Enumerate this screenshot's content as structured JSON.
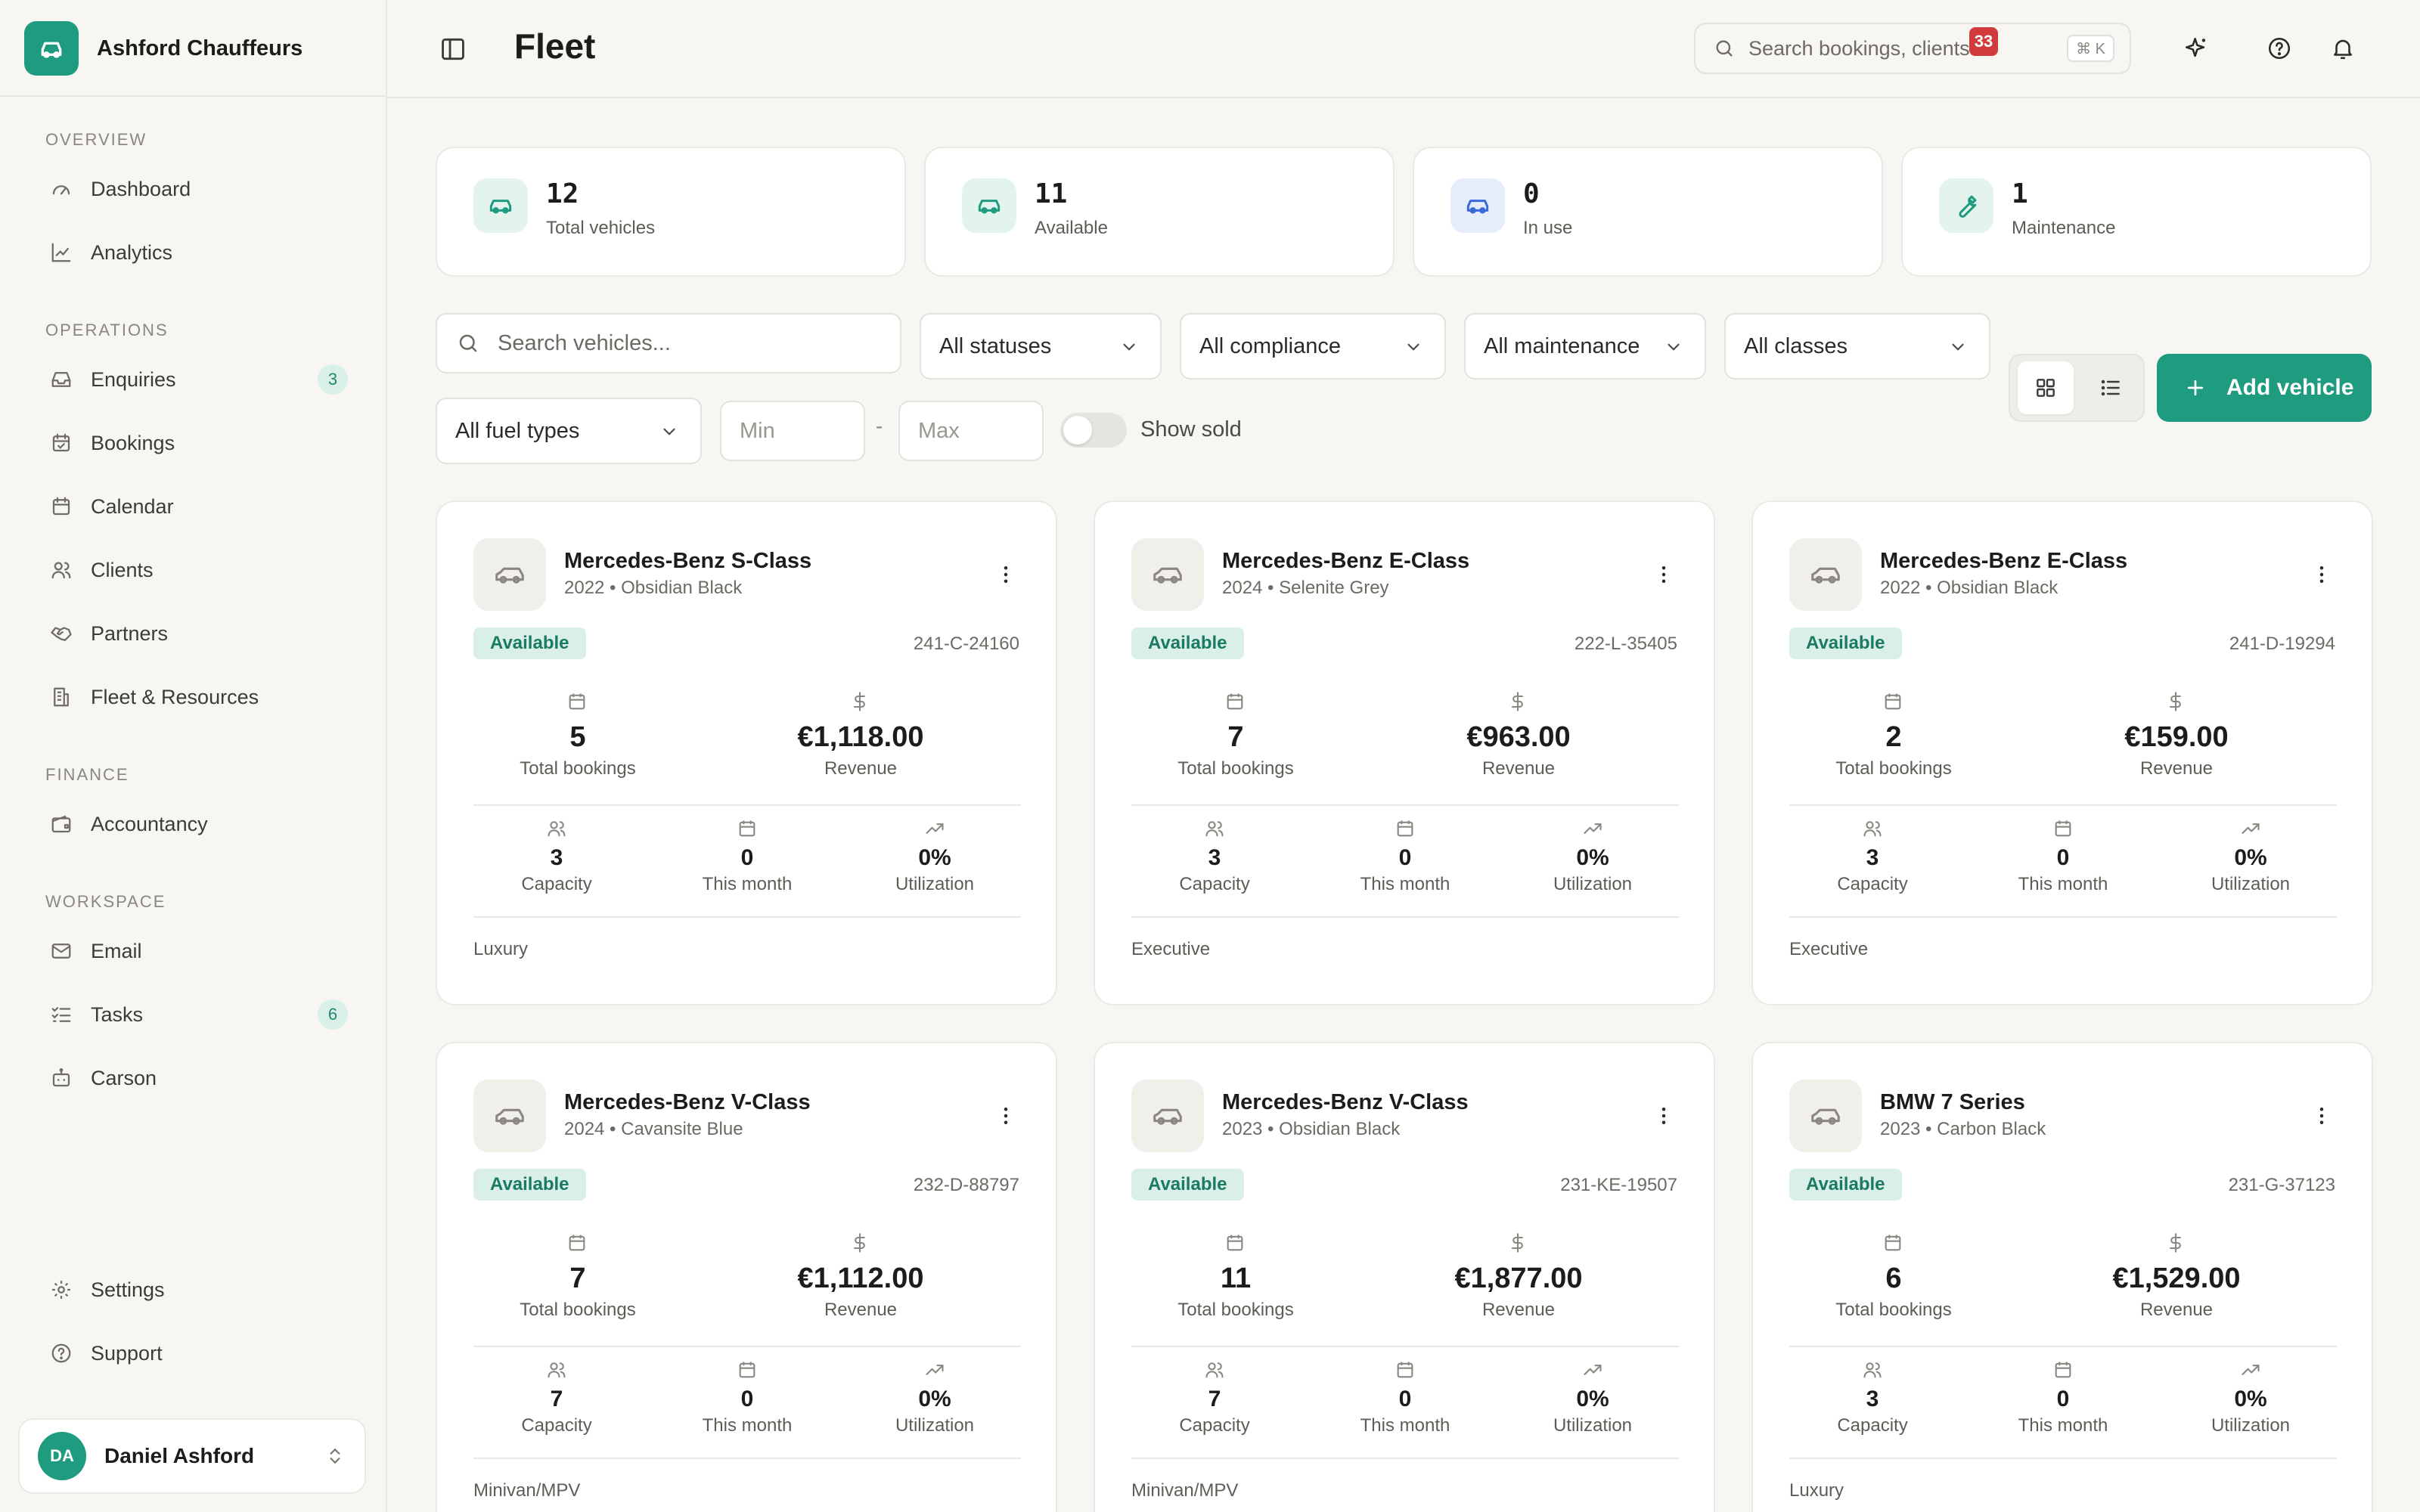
{
  "brand": {
    "name": "Ashford Chauffeurs",
    "accent": "#1f9b7f"
  },
  "sidebar": {
    "sections": [
      {
        "title": "OVERVIEW",
        "items": [
          {
            "label": "Dashboard",
            "icon": "gauge-icon"
          },
          {
            "label": "Analytics",
            "icon": "chart-line-icon"
          }
        ]
      },
      {
        "title": "OPERATIONS",
        "items": [
          {
            "label": "Enquiries",
            "icon": "inbox-icon",
            "badge": "3"
          },
          {
            "label": "Bookings",
            "icon": "calendar-check-icon"
          },
          {
            "label": "Calendar",
            "icon": "calendar-icon"
          },
          {
            "label": "Clients",
            "icon": "users-icon"
          },
          {
            "label": "Partners",
            "icon": "handshake-icon"
          },
          {
            "label": "Fleet & Resources",
            "icon": "building-icon"
          }
        ]
      },
      {
        "title": "FINANCE",
        "items": [
          {
            "label": "Accountancy",
            "icon": "wallet-icon"
          }
        ]
      },
      {
        "title": "WORKSPACE",
        "items": [
          {
            "label": "Email",
            "icon": "mail-icon"
          },
          {
            "label": "Tasks",
            "icon": "list-checks-icon",
            "badge": "6"
          },
          {
            "label": "Carson",
            "icon": "bot-icon"
          }
        ]
      }
    ],
    "footer": [
      {
        "label": "Settings",
        "icon": "gear-icon"
      },
      {
        "label": "Support",
        "icon": "help-circle-icon"
      }
    ],
    "user": {
      "initials": "DA",
      "name": "Daniel Ashford"
    }
  },
  "header": {
    "title": "Fleet",
    "search_placeholder": "Search bookings, clients...",
    "shortcut": "⌘ K",
    "notifications_count": "33"
  },
  "stats": [
    {
      "value": "12",
      "label": "Total vehicles",
      "icon": "car-icon",
      "bg": "#e3f3ee",
      "fg": "#1f9b7f"
    },
    {
      "value": "11",
      "label": "Available",
      "icon": "car-icon",
      "bg": "#e3f3ee",
      "fg": "#1f9b7f"
    },
    {
      "value": "0",
      "label": "In use",
      "icon": "car-icon",
      "bg": "#e5ecfa",
      "fg": "#3a6ad8"
    },
    {
      "value": "1",
      "label": "Maintenance",
      "icon": "wrench-icon",
      "bg": "#e3f3ee",
      "fg": "#1f9b7f"
    }
  ],
  "filters": {
    "search_placeholder": "Search vehicles...",
    "status": "All statuses",
    "compliance": "All compliance",
    "maintenance": "All maintenance",
    "classes": "All classes",
    "fuel": "All fuel types",
    "min_placeholder": "Min",
    "max_placeholder": "Max",
    "range_separator": "-",
    "show_sold_label": "Show sold",
    "show_sold": false,
    "add_label": "Add vehicle"
  },
  "labels": {
    "total_bookings": "Total bookings",
    "revenue": "Revenue",
    "capacity": "Capacity",
    "this_month": "This month",
    "utilization": "Utilization"
  },
  "vehicles": [
    {
      "name": "Mercedes-Benz S-Class",
      "sub": "2022 • Obsidian Black",
      "status": "Available",
      "plate": "241-C-24160",
      "bookings": "5",
      "revenue": "€1,118.00",
      "capacity": "3",
      "month": "0",
      "utilization": "0%",
      "class": "Luxury"
    },
    {
      "name": "Mercedes-Benz E-Class",
      "sub": "2024 • Selenite Grey",
      "status": "Available",
      "plate": "222-L-35405",
      "bookings": "7",
      "revenue": "€963.00",
      "capacity": "3",
      "month": "0",
      "utilization": "0%",
      "class": "Executive"
    },
    {
      "name": "Mercedes-Benz E-Class",
      "sub": "2022 • Obsidian Black",
      "status": "Available",
      "plate": "241-D-19294",
      "bookings": "2",
      "revenue": "€159.00",
      "capacity": "3",
      "month": "0",
      "utilization": "0%",
      "class": "Executive"
    },
    {
      "name": "Mercedes-Benz V-Class",
      "sub": "2024 • Cavansite Blue",
      "status": "Available",
      "plate": "232-D-88797",
      "bookings": "7",
      "revenue": "€1,112.00",
      "capacity": "7",
      "month": "0",
      "utilization": "0%",
      "class": "Minivan/MPV"
    },
    {
      "name": "Mercedes-Benz V-Class",
      "sub": "2023 • Obsidian Black",
      "status": "Available",
      "plate": "231-KE-19507",
      "bookings": "11",
      "revenue": "€1,877.00",
      "capacity": "7",
      "month": "0",
      "utilization": "0%",
      "class": "Minivan/MPV"
    },
    {
      "name": "BMW 7 Series",
      "sub": "2023 • Carbon Black",
      "status": "Available",
      "plate": "231-G-37123",
      "bookings": "6",
      "revenue": "€1,529.00",
      "capacity": "3",
      "month": "0",
      "utilization": "0%",
      "class": "Luxury"
    }
  ]
}
